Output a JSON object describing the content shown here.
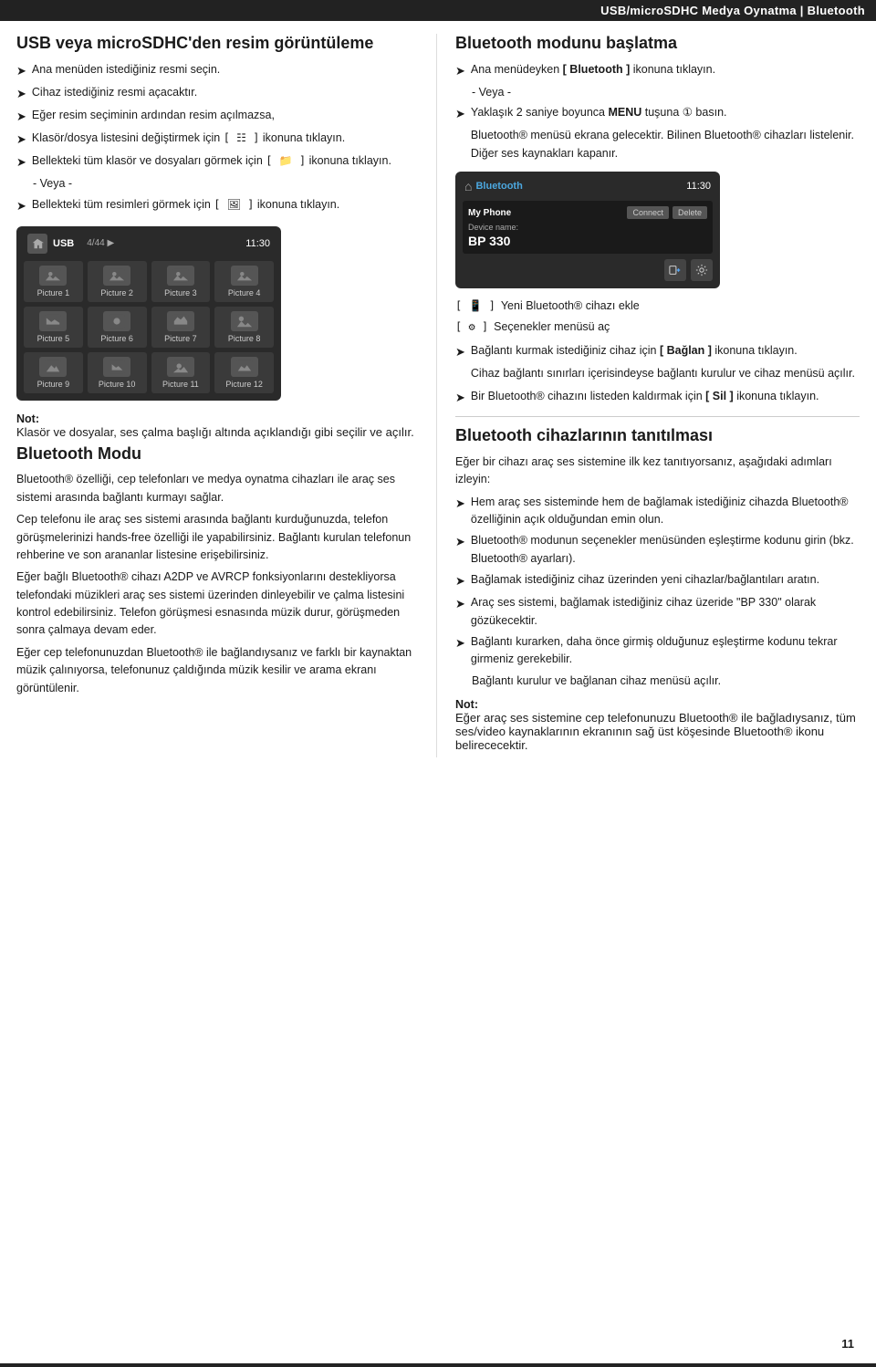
{
  "header": {
    "title": "USB/microSDHC Medya Oynatma | Bluetooth"
  },
  "left": {
    "section1": {
      "heading": "USB veya microSDHC'den resim görüntüleme",
      "bullets": [
        "Ana menüden istediğiniz resmi seçin.",
        "Cihaz istediğiniz resmi açacaktır.",
        "Eğer resim seçiminin ardından resim açılmazsa,",
        "Klasör/dosya listesini değiştirmek için [ ⋮ ] ikonuna tıklayın.",
        "Bellekteki tüm klasör ve dosyaları görmek için [ 📁 ] ikonuna tıklayın.",
        "- Veya -",
        "Bellekteki tüm resimleri görmek için [ 🖼 ] ikonuna tıklayın."
      ]
    },
    "usb_screen": {
      "label": "USB",
      "counter": "4/44",
      "time": "11:30",
      "pictures": [
        "Picture 1",
        "Picture 2",
        "Picture 3",
        "Picture 4",
        "Picture 5",
        "Picture 6",
        "Picture 7",
        "Picture 8",
        "Picture 9",
        "Picture 10",
        "Picture 11",
        "Picture 12"
      ]
    },
    "note": {
      "label": "Not:",
      "text": "Klasör ve dosyalar, ses çalma başlığı altında açıklandığı gibi seçilir ve açılır."
    },
    "section2": {
      "heading": "Bluetooth Modu",
      "para1": "Bluetooth® özelliği, cep telefonları ve medya oynatma cihazları ile araç ses sistemi arasında bağlantı kurmayı sağlar.",
      "para2": "Cep telefonu ile araç ses sistemi arasında bağlantı kurduğunuzda, telefon görüşmelerinizi hands-free özelliği ile yapabilirsiniz. Bağlantı kurulan telefonun rehberine ve son arananlar listesine erişebilirsiniz.",
      "para3": "Eğer bağlı Bluetooth® cihazı A2DP ve AVRCP fonksiyonlarını destekliyorsa telefondaki müzikleri araç ses sistemi üzerinden dinleyebilir ve çalma listesini kontrol edebilirsiniz. Telefon görüşmesi esnasında müzik durur, görüşmeden sonra çalmaya devam eder.",
      "para4": "Eğer cep telefonunuzdan Bluetooth® ile bağlandıysanız ve farklı bir kaynaktan müzik çalınıyorsa, telefonunuz çaldığında müzik kesilir ve arama ekranı görüntülenir."
    }
  },
  "right": {
    "section1": {
      "heading": "Bluetooth modunu başlatma",
      "bullets": [
        "Ana menüdeyken [ Bluetooth ] ikonuna tıklayın.",
        "- Veya -",
        "Yaklaşık 2 saniye boyunca MENU tuşuna 2 basın.",
        "Bluetooth® menüsü ekrana gelecektir. Bilinen Bluetooth® cihazları listelenir. Diğer ses kaynakları kapanır."
      ]
    },
    "bt_screen": {
      "title": "Bluetooth",
      "time": "11:30",
      "device": "My Phone",
      "btn_connect": "Connect",
      "btn_delete": "Delete",
      "device_name_label": "Device name:",
      "bp_label": "BP 330"
    },
    "icon_notes": [
      "[ 📱 ]  Yeni Bluetooth® cihazı ekle",
      "[ ⚙ ]  Seçenekler menüsü aç"
    ],
    "bullets2": [
      "Bağlantı kurmak istediğiniz cihaz için [ Bağlan ] ikonuna tıklayın.",
      "Cihaz bağlantı sınırları içerisindeyse bağlantı kurulur ve cihaz menüsü açılır.",
      "Bir Bluetooth® cihazını listeden kaldırmak için [ Sil ] ikonuna tıklayın."
    ],
    "section2": {
      "heading": "Bluetooth cihazlarının tanıtılması",
      "intro": "Eğer bir cihazı araç ses sistemine ilk kez tanıtıyorsanız, aşağıdaki adımları izleyin:",
      "bullets": [
        "Hem araç ses sisteminde hem de bağlamak istediğiniz cihazda Bluetooth® özelliğinin açık olduğundan emin olun.",
        "Bluetooth® modunun seçenekler menüsünden eşleştirme kodunu girin (bkz. Bluetooth® ayarları).",
        "Bağlamak istediğiniz cihaz üzerinden yeni cihazlar/bağlantıları aratın.",
        "Araç ses sistemi, bağlamak istediğiniz cihaz üzeride \"BP 330\" olarak gözükecektir.",
        "Bağlantı kurarken, daha önce girmiş olduğunuz eşleştirme kodunu tekrar girmeniz gerekebilir.",
        "Bağlantı kurulur ve bağlanan cihaz menüsü açılır."
      ]
    },
    "note2": {
      "label": "Not:",
      "text": "Eğer araç ses sistemine cep telefonunuzu Bluetooth® ile bağladıysanız, tüm ses/video kaynaklarının ekranının sağ üst köşesinde Bluetooth® ikonu belirececektir."
    }
  },
  "page_number": "11"
}
